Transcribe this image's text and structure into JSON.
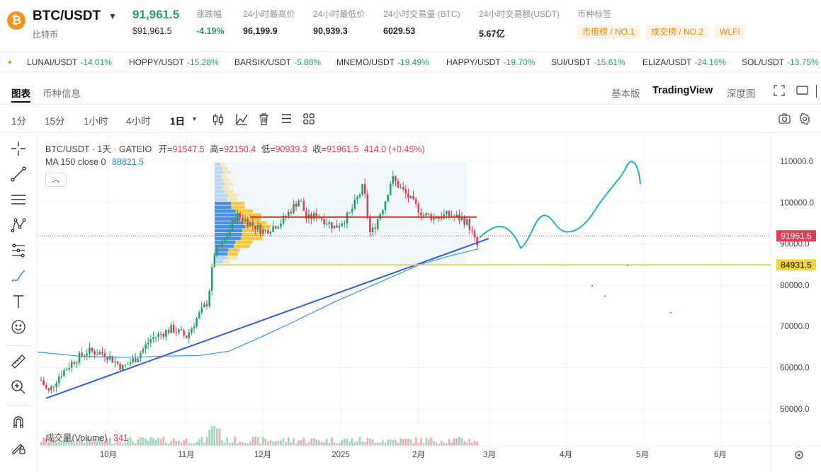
{
  "header": {
    "pair": "BTC/USDT",
    "coin_glyph": "₿",
    "coin_name": "比特币",
    "last_price": "91,961.5",
    "fiat_price": "$91,961.5",
    "stats": [
      {
        "label": "涨跌幅",
        "value": "-4.19%"
      },
      {
        "label": "24小时最高价",
        "value": "96,199.9"
      },
      {
        "label": "24小时最低价",
        "value": "90,939.3"
      },
      {
        "label": "24小时交易量 (BTC)",
        "value": "6029.53"
      },
      {
        "label": "24小时交易额(USDT)",
        "value": "5.67亿"
      },
      {
        "label": "币种标签",
        "value": ""
      }
    ],
    "tags": [
      "市值榜 / NO.1",
      "成交榜 / NO.2",
      "WLFI"
    ]
  },
  "ticker": [
    {
      "pair": "LUNAI/USDT",
      "change": "-14.01%"
    },
    {
      "pair": "HOPPY/USDT",
      "change": "-15.28%"
    },
    {
      "pair": "BARSIK/USDT",
      "change": "-5.88%"
    },
    {
      "pair": "MNEMO/USDT",
      "change": "-19.49%"
    },
    {
      "pair": "HAPPY/USDT",
      "change": "-19.70%"
    },
    {
      "pair": "SUI/USDT",
      "change": "-15.61%"
    },
    {
      "pair": "ELIZA/USDT",
      "change": "-24.16%"
    },
    {
      "pair": "SOL/USDT",
      "change": "-13.75%"
    }
  ],
  "tabs": {
    "chart": "图表",
    "info": "币种信息",
    "basic": "基本版",
    "tv": "TradingView",
    "depth": "深度图"
  },
  "timeframes": [
    "1分",
    "15分",
    "1小时",
    "4小时",
    "1日"
  ],
  "legend": {
    "title": "BTC/USDT · 1天 · GATEIO",
    "open_label": "开",
    "open": "91547.5",
    "high_label": "高",
    "high": "92150.4",
    "low_label": "低",
    "low": "90939.3",
    "close_label": "收",
    "close": "91961.5",
    "change": "414.0 (+0.45%)",
    "ma_label": "MA 150 close 0",
    "ma_value": "88821.5",
    "vol_label": "成交量(Volume)",
    "vol_value": "341"
  },
  "colors": {
    "up": "#21a366",
    "down": "#e23e57",
    "ma": "#2f9be0",
    "trend": "#2e5ee8",
    "hline_red": "#e02424",
    "hline_yellow": "#f3d43a",
    "sketch": "#1bb3c8"
  },
  "chart_data": {
    "type": "candlestick",
    "y_ticks": [
      "110000.0",
      "100000.0",
      "90000.0",
      "80000.0",
      "70000.0",
      "60000.0",
      "50000.0"
    ],
    "x_ticks": [
      "10月",
      "11月",
      "12月",
      "2025",
      "2月",
      "3月",
      "4月",
      "5月",
      "6月"
    ],
    "ylim": [
      47000,
      113000
    ],
    "last_price_label": "91961.5",
    "hline_price_label": "84931.5",
    "hline_price": 84931.5,
    "red_level": 96500,
    "ma_last": 88821.5
  }
}
